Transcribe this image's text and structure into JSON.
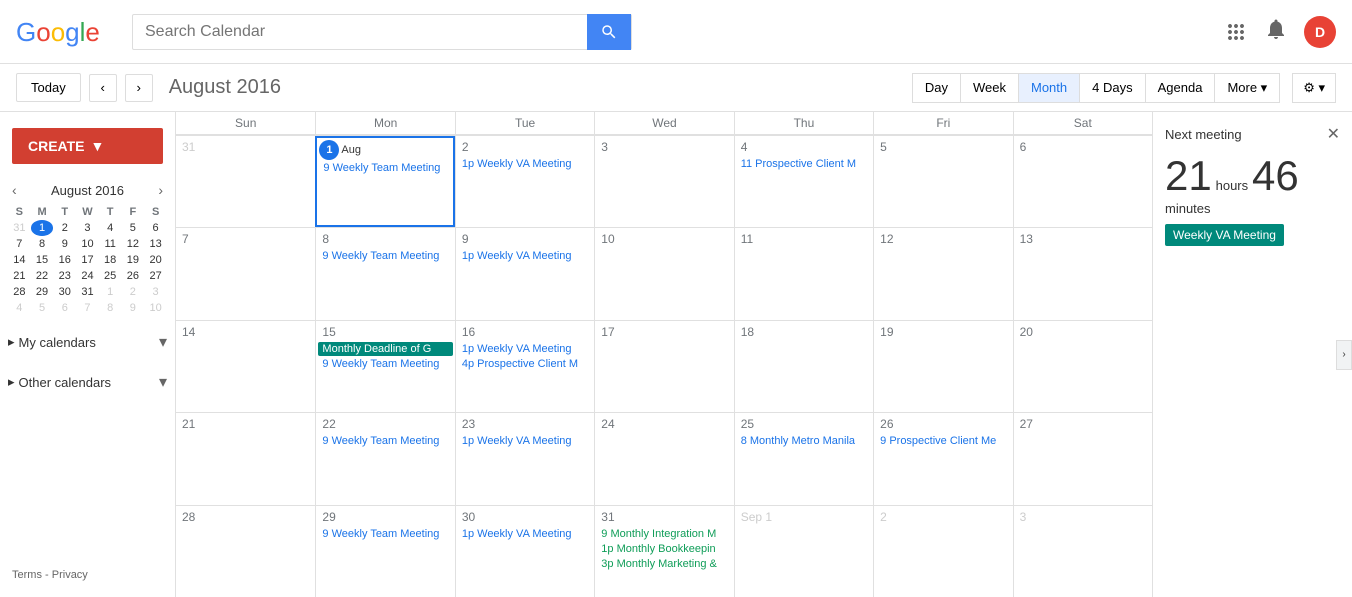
{
  "header": {
    "logo_text": "Google",
    "search_placeholder": "Search Calendar",
    "avatar_letter": "D"
  },
  "toolbar": {
    "today_label": "Today",
    "month_title": "August 2016",
    "views": [
      "Day",
      "Week",
      "Month",
      "4 Days",
      "Agenda",
      "More ▾"
    ],
    "active_view": "Month"
  },
  "sidebar": {
    "create_label": "CREATE",
    "mini_cal": {
      "title": "August 2016",
      "days_header": [
        "S",
        "M",
        "T",
        "W",
        "T",
        "F",
        "S"
      ],
      "weeks": [
        [
          "31",
          "1",
          "2",
          "3",
          "4",
          "5",
          "6"
        ],
        [
          "7",
          "8",
          "9",
          "10",
          "11",
          "12",
          "13"
        ],
        [
          "14",
          "15",
          "16",
          "17",
          "18",
          "19",
          "20"
        ],
        [
          "21",
          "22",
          "23",
          "24",
          "25",
          "26",
          "27"
        ],
        [
          "28",
          "29",
          "30",
          "31",
          "1",
          "2",
          "3"
        ],
        [
          "4",
          "5",
          "6",
          "7",
          "8",
          "9",
          "10"
        ]
      ],
      "today": "1"
    },
    "my_calendars_label": "My calendars",
    "other_calendars_label": "Other calendars",
    "footer": {
      "terms_label": "Terms",
      "privacy_label": "Privacy",
      "separator": " - "
    }
  },
  "calendar": {
    "day_headers": [
      "Sun",
      "Mon",
      "Tue",
      "Wed",
      "Thu",
      "Fri",
      "Sat"
    ],
    "weeks": [
      {
        "days": [
          {
            "num": "31",
            "other": true,
            "events": []
          },
          {
            "num": "Aug 1",
            "today": true,
            "events": [
              "9 Weekly Team Meeting"
            ]
          },
          {
            "num": "2",
            "events": [
              "1p Weekly VA Meeting"
            ]
          },
          {
            "num": "3",
            "events": []
          },
          {
            "num": "4",
            "events": [
              "11 Prospective Client M"
            ]
          },
          {
            "num": "5",
            "events": []
          },
          {
            "num": "6",
            "events": []
          }
        ]
      },
      {
        "days": [
          {
            "num": "7",
            "events": []
          },
          {
            "num": "8",
            "events": [
              "9 Weekly Team Meeting"
            ]
          },
          {
            "num": "9",
            "events": [
              "1p Weekly VA Meeting"
            ]
          },
          {
            "num": "10",
            "events": []
          },
          {
            "num": "11",
            "events": []
          },
          {
            "num": "12",
            "events": []
          },
          {
            "num": "13",
            "events": []
          }
        ]
      },
      {
        "days": [
          {
            "num": "14",
            "events": []
          },
          {
            "num": "15",
            "events": [
              "Monthly Deadline of G",
              "9 Weekly Team Meeting"
            ],
            "has_badge": true
          },
          {
            "num": "16",
            "events": [
              "1p Weekly VA Meeting",
              "4p Prospective Client M"
            ]
          },
          {
            "num": "17",
            "events": []
          },
          {
            "num": "18",
            "events": []
          },
          {
            "num": "19",
            "events": []
          },
          {
            "num": "20",
            "events": []
          }
        ]
      },
      {
        "days": [
          {
            "num": "21",
            "events": []
          },
          {
            "num": "22",
            "events": [
              "9 Weekly Team Meeting"
            ]
          },
          {
            "num": "23",
            "events": [
              "1p Weekly VA Meeting"
            ]
          },
          {
            "num": "24",
            "events": []
          },
          {
            "num": "25",
            "events": [
              "8 Monthly Metro Manila"
            ]
          },
          {
            "num": "26",
            "events": [
              "9 Prospective Client Me"
            ]
          },
          {
            "num": "27",
            "events": []
          }
        ]
      },
      {
        "days": [
          {
            "num": "28",
            "events": []
          },
          {
            "num": "29",
            "events": [
              "9 Weekly Team Meeting"
            ]
          },
          {
            "num": "30",
            "events": [
              "1p Weekly VA Meeting"
            ]
          },
          {
            "num": "31",
            "events": [
              "9 Monthly Integration M",
              "1p Monthly Bookkeepin",
              "3p Monthly Marketing &"
            ]
          },
          {
            "num": "Sep 1",
            "other": true,
            "events": []
          },
          {
            "num": "2",
            "other": true,
            "events": []
          },
          {
            "num": "3",
            "other": true,
            "events": []
          }
        ]
      }
    ]
  },
  "right_panel": {
    "title": "Next meeting",
    "hours": "21",
    "minutes": "46",
    "hours_label": "hours",
    "minutes_label": "minutes",
    "meeting_name": "Weekly VA Meeting"
  }
}
